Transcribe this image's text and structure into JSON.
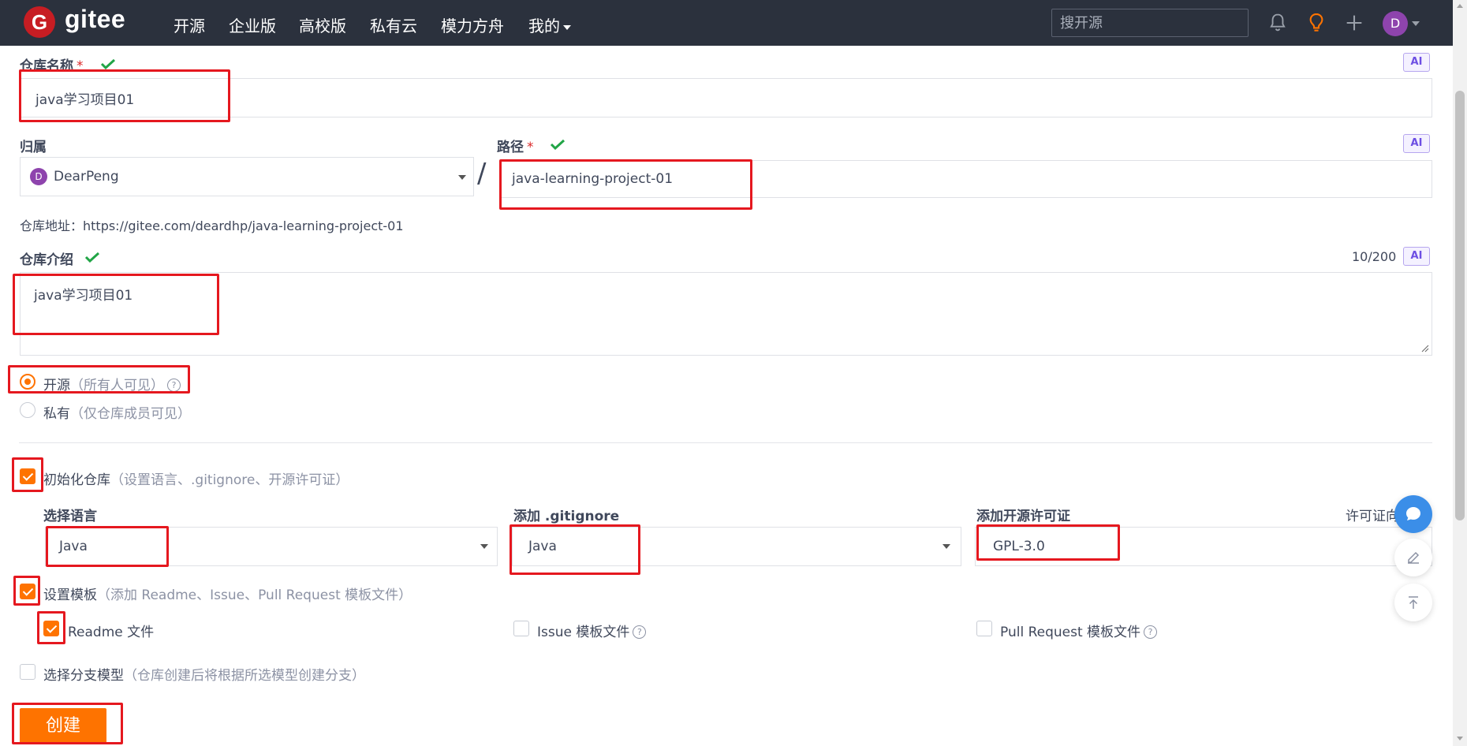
{
  "nav": {
    "logo_text": "gitee",
    "logo_glyph": "G",
    "items": [
      "开源",
      "企业版",
      "高校版",
      "私有云",
      "模力方舟",
      "我的"
    ],
    "search_placeholder": "搜开源",
    "avatar_letter": "D"
  },
  "form": {
    "repo_name_label": "仓库名称",
    "required_mark": "*",
    "repo_name_value": "java学习项目01",
    "ai_label": "AI",
    "owner_label": "归属",
    "owner_avatar": "D",
    "owner_value": "DearPeng",
    "slash": "/",
    "path_label": "路径",
    "path_value": "java-learning-project-01",
    "repo_url": "仓库地址：https://gitee.com/deardhp/java-learning-project-01",
    "intro_label": "仓库介绍",
    "intro_count": "10/200",
    "intro_value": "java学习项目01",
    "public_label": "开源",
    "public_hint": "（所有人可见）",
    "private_label": "私有",
    "private_hint": "（仅仓库成员可见）",
    "init_label": "初始化仓库",
    "init_hint": "（设置语言、.gitignore、开源许可证）",
    "lang_label": "选择语言",
    "lang_value": "Java",
    "gitignore_label": "添加 .gitignore",
    "gitignore_value": "Java",
    "license_label": "添加开源许可证",
    "license_value": "GPL-3.0",
    "license_link": "许可证向导",
    "template_label": "设置模板",
    "template_hint": "（添加 Readme、Issue、Pull Request 模板文件）",
    "readme_label": "Readme 文件",
    "issue_label": "Issue 模板文件",
    "pr_label": "Pull Request 模板文件",
    "branch_label": "选择分支模型",
    "branch_hint": "（仓库创建后将根据所选模型创建分支）",
    "create_button": "创建"
  },
  "colors": {
    "accent": "#fe7300",
    "annotation": "#e5181f",
    "nav_bg": "#2b313d",
    "check": "#21a546"
  }
}
